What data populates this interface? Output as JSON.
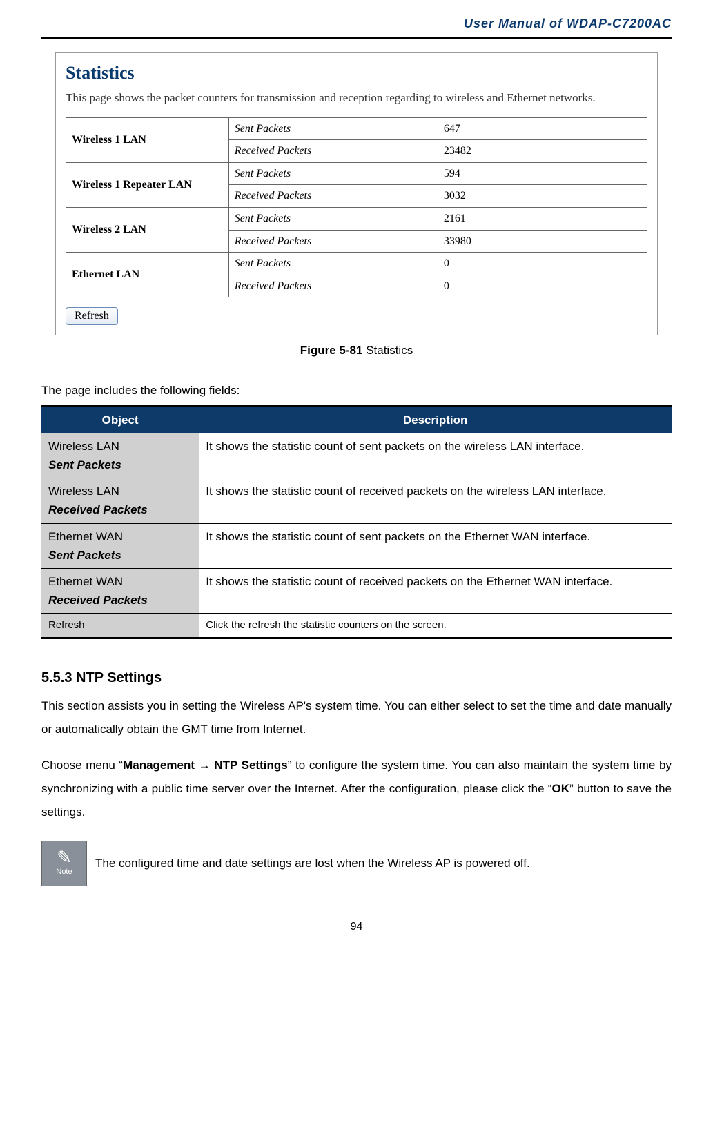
{
  "header": {
    "title": "User Manual of WDAP-C7200AC"
  },
  "figure": {
    "panel_title": "Statistics",
    "panel_desc": "This page shows the packet counters for transmission and reception regarding to wireless and Ethernet networks.",
    "rows": [
      {
        "iface": "Wireless 1 LAN",
        "sent_label": "Sent Packets",
        "sent_val": "647",
        "recv_label": "Received Packets",
        "recv_val": "23482"
      },
      {
        "iface": "Wireless 1 Repeater LAN",
        "sent_label": "Sent Packets",
        "sent_val": "594",
        "recv_label": "Received Packets",
        "recv_val": "3032"
      },
      {
        "iface": "Wireless 2 LAN",
        "sent_label": "Sent Packets",
        "sent_val": "2161",
        "recv_label": "Received Packets",
        "recv_val": "33980"
      },
      {
        "iface": "Ethernet LAN",
        "sent_label": "Sent Packets",
        "sent_val": "0",
        "recv_label": "Received Packets",
        "recv_val": "0"
      }
    ],
    "refresh_label": "Refresh",
    "caption_num": "Figure 5-81",
    "caption_text": " Statistics"
  },
  "intro": "The page includes the following fields:",
  "field_table": {
    "head_object": "Object",
    "head_desc": "Description",
    "rows": [
      {
        "obj_line1": "Wireless LAN",
        "obj_line2": "Sent Packets",
        "desc": "It shows the statistic count of sent packets on the wireless LAN interface."
      },
      {
        "obj_line1": "Wireless LAN",
        "obj_line2": "Received Packets",
        "desc": "It shows the statistic count of received packets on the wireless LAN interface."
      },
      {
        "obj_line1": "Ethernet WAN",
        "obj_line2": "Sent Packets",
        "desc": "It shows the statistic count of sent packets on the Ethernet WAN interface."
      },
      {
        "obj_line1": "Ethernet WAN",
        "obj_line2": "Received Packets",
        "desc": "It shows the statistic count of received packets on the Ethernet WAN interface."
      }
    ],
    "refresh_row": {
      "obj": "Refresh",
      "desc": "Click the refresh the statistic counters on the screen."
    }
  },
  "section": {
    "number_title": "5.5.3  NTP Settings",
    "para1": "This section assists you in setting the Wireless AP's system time. You can either select to set the time and date manually or automatically obtain the GMT time from Internet.",
    "para2_pre": "Choose menu “",
    "para2_b1": "Management",
    "para2_arrow": " → ",
    "para2_b2": "NTP Settings",
    "para2_mid": "” to configure the system time. You can also maintain the system time by synchronizing with a public time server over the Internet. After the configuration, please click the “",
    "para2_b3": "OK",
    "para2_post": "” button to save the settings."
  },
  "note": {
    "label": "Note",
    "text": "The configured time and date settings are lost when the Wireless AP is powered off."
  },
  "page_number": "94"
}
